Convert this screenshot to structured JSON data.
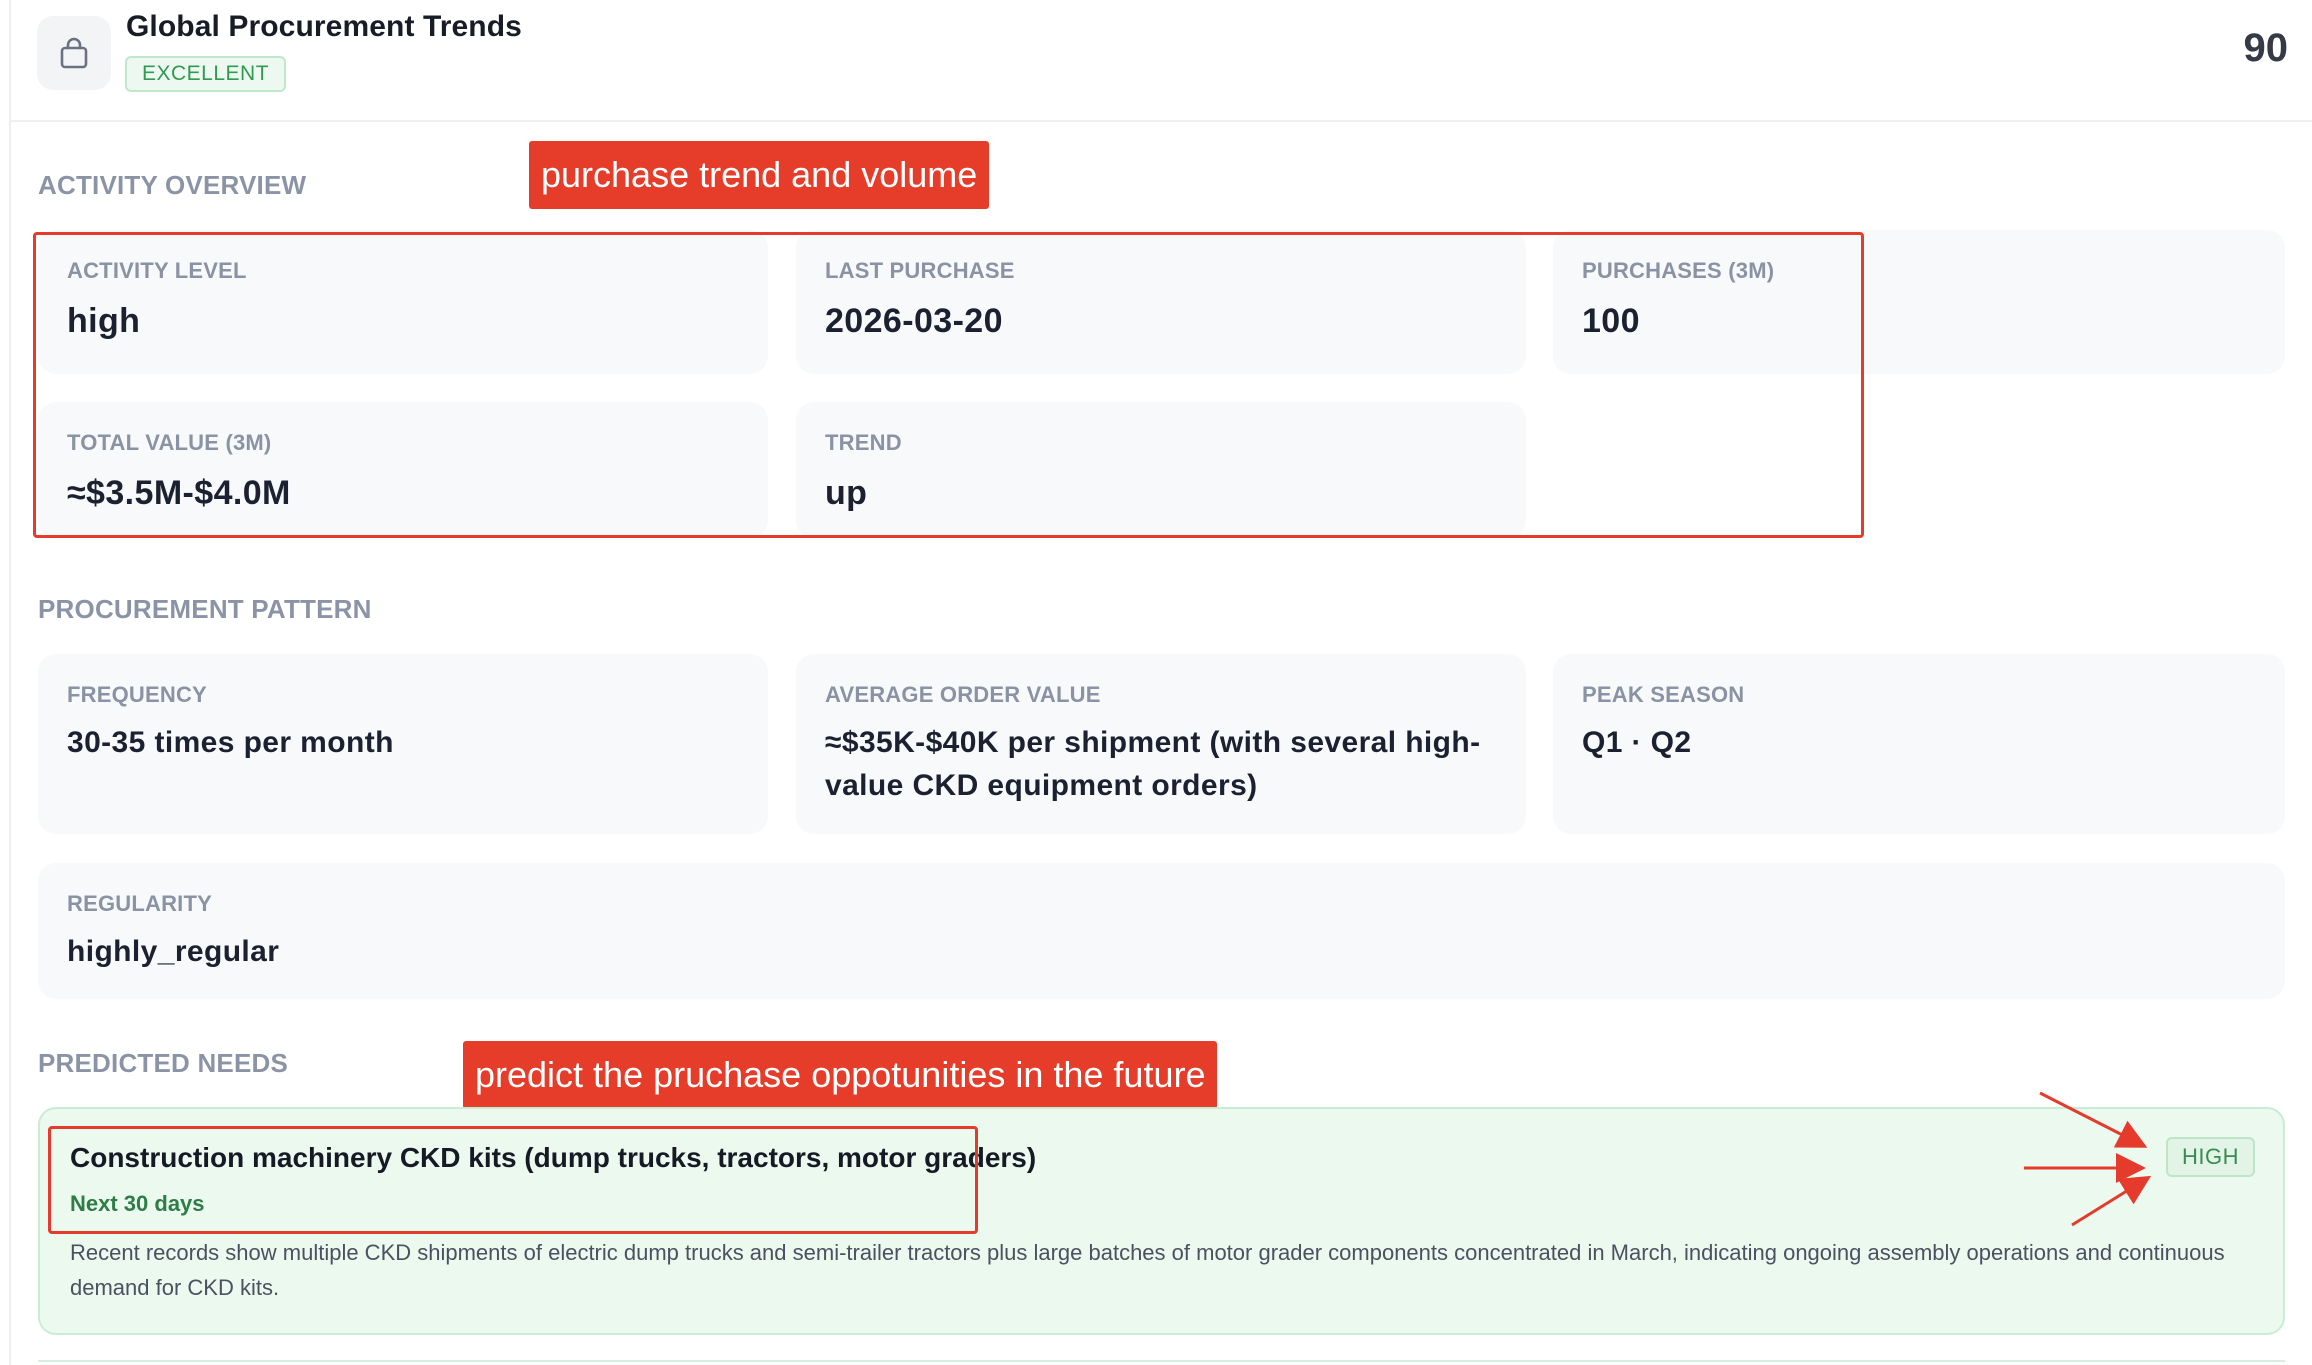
{
  "header": {
    "title": "Global Procurement Trends",
    "badge": "EXCELLENT",
    "score": "90",
    "icon": "shopping-bag-icon"
  },
  "activity": {
    "section_title": "ACTIVITY OVERVIEW",
    "annotation": "purchase trend and volume",
    "cards": [
      {
        "label": "ACTIVITY LEVEL",
        "value": "high"
      },
      {
        "label": "LAST PURCHASE",
        "value": "2026-03-20"
      },
      {
        "label": "PURCHASES (3M)",
        "value": "100"
      },
      {
        "label": "TOTAL VALUE (3M)",
        "value": "≈$3.5M-$4.0M"
      },
      {
        "label": "TREND",
        "value": "up"
      }
    ]
  },
  "pattern": {
    "section_title": "PROCUREMENT PATTERN",
    "cards": [
      {
        "label": "FREQUENCY",
        "value": "30-35 times per month"
      },
      {
        "label": "AVERAGE ORDER VALUE",
        "value": "≈$35K-$40K per shipment (with several high-value CKD equipment orders)"
      },
      {
        "label": "PEAK SEASON",
        "value": "Q1 · Q2"
      },
      {
        "label": "REGULARITY",
        "value": "highly_regular"
      }
    ]
  },
  "needs": {
    "section_title": "PREDICTED NEEDS",
    "annotation": "predict the pruchase oppotunities in the future",
    "items": [
      {
        "title": "Construction machinery CKD kits (dump trucks, tractors, motor graders)",
        "timeframe": "Next 30 days",
        "priority": "HIGH",
        "description": "Recent records show multiple CKD shipments of electric dump trucks and semi-trailer tractors plus large batches of motor grader components concentrated in March, indicating ongoing assembly operations and continuous demand for CKD kits."
      }
    ]
  },
  "colors": {
    "annotation": "#e63d2a",
    "success": "#2f9a52",
    "card_bg": "#f8f9fb",
    "need_bg": "#ecf9ee"
  }
}
